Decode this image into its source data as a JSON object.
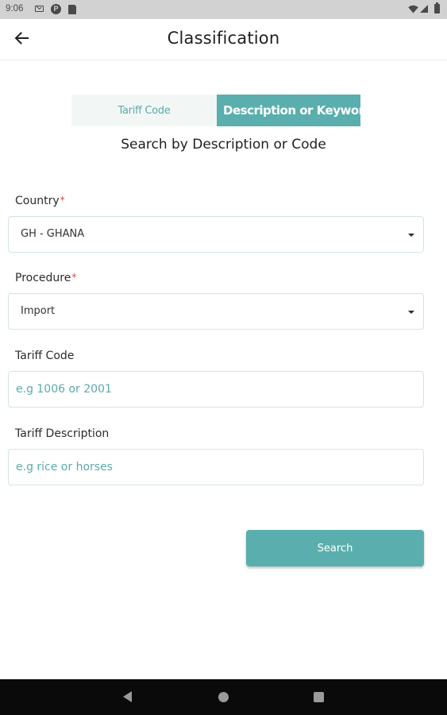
{
  "status_bar": {
    "time": "9:06",
    "icons": [
      "mail-icon",
      "p-icon",
      "sd-card-icon",
      "wifi-icon",
      "signal-icon",
      "battery-icon"
    ],
    "p_glyph": "P"
  },
  "app_bar": {
    "title": "Classification",
    "back_icon": "arrow-left-icon"
  },
  "toggle": {
    "tabs": [
      {
        "label": "Tariff Code",
        "active": false
      },
      {
        "label": "Description or Keyword",
        "active": true
      }
    ]
  },
  "subtitle": "Search by Description or Code",
  "form": {
    "country": {
      "label": "Country",
      "required_mark": "*",
      "value": "GH - GHANA"
    },
    "procedure": {
      "label": "Procedure",
      "required_mark": "*",
      "value": "Import"
    },
    "tariff_code": {
      "label": "Tariff Code",
      "value": "",
      "placeholder": "e.g 1006 or 2001"
    },
    "tariff_description": {
      "label": "Tariff Description",
      "value": "",
      "placeholder": "e.g rice or horses"
    }
  },
  "search_button": {
    "label": "Search"
  },
  "nav_bar": {
    "icons": [
      "nav-back-icon",
      "nav-home-icon",
      "nav-recents-icon"
    ]
  },
  "colors": {
    "accent": "#5aafae",
    "accent_light_bg": "#f2f7f6",
    "placeholder": "#5aabab",
    "required": "#e04444",
    "field_border": "#cfe6e4",
    "status_bar_bg": "#d2d2d2",
    "nav_bar_bg": "#0a0a0a"
  }
}
